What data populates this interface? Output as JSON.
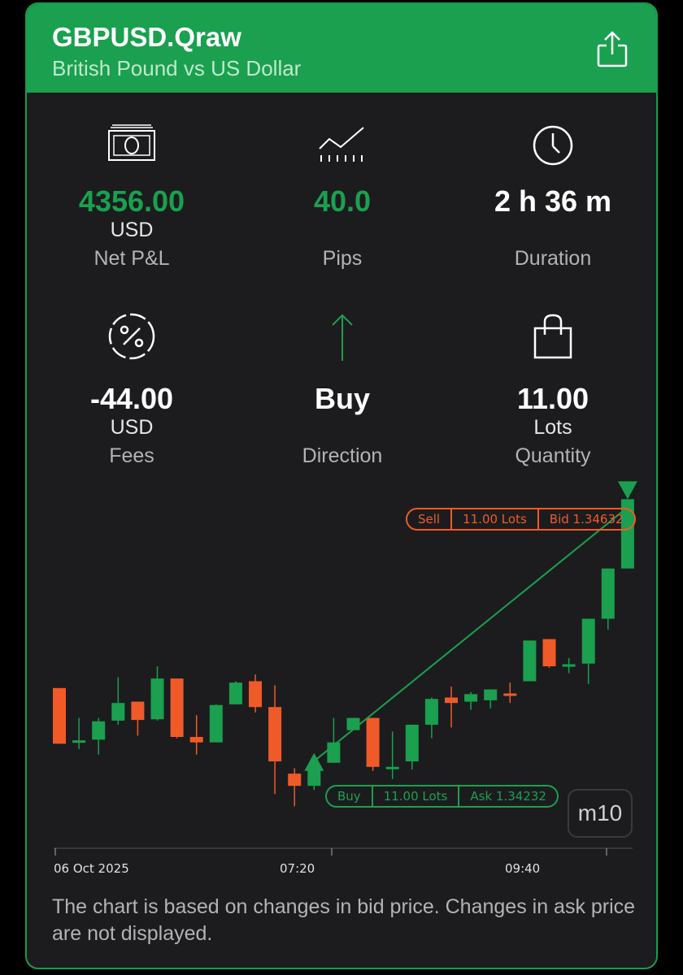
{
  "header": {
    "symbol": "GBPUSD.Qraw",
    "description": "British Pound vs US Dollar",
    "share_icon": "share-icon",
    "background_color": "#1aa04f"
  },
  "stats": [
    {
      "icon": "money-icon",
      "value": "4356.00",
      "unit": "USD",
      "label": "Net P&L",
      "value_color": "#1aa04f"
    },
    {
      "icon": "chart-line-icon",
      "value": "40.0",
      "unit": "",
      "label": "Pips",
      "value_color": "#1aa04f"
    },
    {
      "icon": "clock-icon",
      "value": "2 h 36 m",
      "unit": "",
      "label": "Duration",
      "value_color": "#ffffff"
    },
    {
      "icon": "percent-badge-icon",
      "value": "-44.00",
      "unit": "USD",
      "label": "Fees",
      "value_color": "#ffffff"
    },
    {
      "icon": "arrow-up-icon",
      "value": "Buy",
      "unit": "",
      "label": "Direction",
      "value_color": "#ffffff"
    },
    {
      "icon": "shopping-bag-icon",
      "value": "11.00",
      "unit": "Lots",
      "label": "Quantity",
      "value_color": "#ffffff"
    }
  ],
  "chart": {
    "timeframe": "m10",
    "x_labels": [
      "06 Oct 2025",
      "07:20",
      "09:40"
    ],
    "sell_order": {
      "side": "Sell",
      "lots": "11.00 Lots",
      "price": "Bid 1.34632"
    },
    "buy_order": {
      "side": "Buy",
      "lots": "11.00 Lots",
      "price": "Ask 1.34232"
    },
    "up_color": "#1aa04f",
    "down_color": "#f05a28"
  },
  "chart_data": {
    "type": "candlestick",
    "x": [
      "06 Oct 2025",
      "",
      "",
      "",
      "",
      "",
      "",
      "",
      "",
      "",
      "",
      "",
      "07:20",
      "",
      "",
      "",
      "",
      "",
      "",
      "",
      "",
      "",
      "",
      "",
      "",
      "09:40",
      "",
      "",
      "",
      ""
    ],
    "ohlc": [
      [
        1.34354,
        1.34354,
        1.34272,
        1.34272
      ],
      [
        1.34274,
        1.3431,
        1.34264,
        1.34277
      ],
      [
        1.34278,
        1.3431,
        1.34256,
        1.34305
      ],
      [
        1.34306,
        1.3437,
        1.343,
        1.34332
      ],
      [
        1.34334,
        1.34334,
        1.34284,
        1.34307
      ],
      [
        1.34308,
        1.34386,
        1.34306,
        1.34368
      ],
      [
        1.34368,
        1.34368,
        1.3428,
        1.34282
      ],
      [
        1.34282,
        1.34314,
        1.34256,
        1.34274
      ],
      [
        1.34274,
        1.3433,
        1.34274,
        1.34329
      ],
      [
        1.3433,
        1.34364,
        1.3433,
        1.34362
      ],
      [
        1.34364,
        1.34374,
        1.34318,
        1.34326
      ],
      [
        1.34326,
        1.34358,
        1.34198,
        1.34246
      ],
      [
        1.34228,
        1.34236,
        1.3418,
        1.3421
      ],
      [
        1.3421,
        1.34256,
        1.34204,
        1.3424
      ],
      [
        1.34244,
        1.3431,
        1.34244,
        1.34274
      ],
      [
        1.34292,
        1.3431,
        1.34294,
        1.3431
      ],
      [
        1.3431,
        1.3431,
        1.34232,
        1.34238
      ],
      [
        1.34238,
        1.3429,
        1.3422,
        1.34238
      ],
      [
        1.34246,
        1.343,
        1.34234,
        1.343
      ],
      [
        1.343,
        1.3434,
        1.3428,
        1.34338
      ],
      [
        1.3434,
        1.34356,
        1.34296,
        1.34332
      ],
      [
        1.34334,
        1.34348,
        1.34322,
        1.34345
      ],
      [
        1.34336,
        1.34352,
        1.34324,
        1.34352
      ],
      [
        1.34346,
        1.34362,
        1.34332,
        1.34345
      ],
      [
        1.34364,
        1.34412,
        1.34364,
        1.34424
      ],
      [
        1.34426,
        1.34426,
        1.34384,
        1.34386
      ],
      [
        1.34386,
        1.34398,
        1.34376,
        1.34389
      ],
      [
        1.3439,
        1.34452,
        1.3436,
        1.34456
      ],
      [
        1.34456,
        1.3453,
        1.3444,
        1.3453
      ],
      [
        1.3453,
        1.34632,
        1.3453,
        1.34632
      ]
    ],
    "xlabel": "",
    "ylabel": "",
    "ylim": [
      1.3416,
      1.3466
    ],
    "entry": {
      "side": "Buy",
      "price": 1.34232
    },
    "exit": {
      "side": "Sell",
      "price": 1.34632
    },
    "grid": false
  },
  "footnote": "The chart is based on changes in bid price. Changes in ask price are not displayed."
}
